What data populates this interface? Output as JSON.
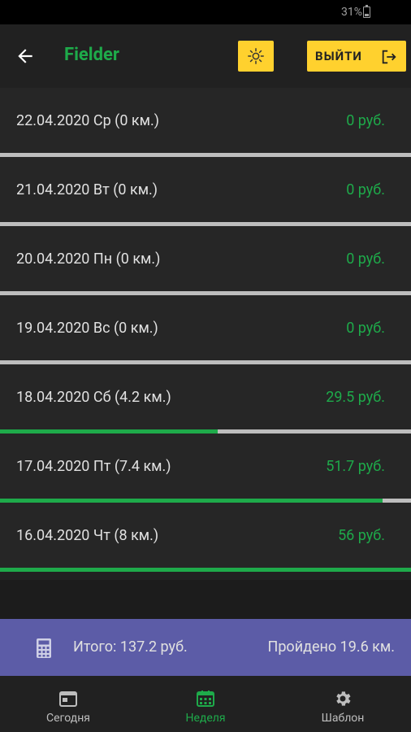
{
  "status_bar": {
    "battery": "31%"
  },
  "app_bar": {
    "title": "Fielder",
    "logout_label": "ВЫЙТИ"
  },
  "days": [
    {
      "label": "22.04.2020 Ср (0 км.)",
      "amount": "0 руб.",
      "progress": 0.0
    },
    {
      "label": "21.04.2020 Вт (0 км.)",
      "amount": "0 руб.",
      "progress": 0.0
    },
    {
      "label": "20.04.2020 Пн (0 км.)",
      "amount": "0 руб.",
      "progress": 0.0
    },
    {
      "label": "19.04.2020 Вс (0 км.)",
      "amount": "0 руб.",
      "progress": 0.0
    },
    {
      "label": "18.04.2020 Сб (4.2 км.)",
      "amount": "29.5 руб.",
      "progress": 0.53
    },
    {
      "label": "17.04.2020 Пт (7.4 км.)",
      "amount": "51.7 руб.",
      "progress": 0.93
    },
    {
      "label": "16.04.2020 Чт (8 км.)",
      "amount": "56 руб.",
      "progress": 1.0
    }
  ],
  "summary": {
    "total": "Итого: 137.2 руб.",
    "distance": "Пройдено 19.6 км."
  },
  "nav": [
    {
      "label": "Сегодня",
      "icon": "calendar-today-icon",
      "active": false
    },
    {
      "label": "Неделя",
      "icon": "calendar-week-icon",
      "active": true
    },
    {
      "label": "Шаблон",
      "icon": "gear-icon",
      "active": false
    }
  ],
  "colors": {
    "accent": "#1eaa4a",
    "button": "#ffd12e",
    "summary_bg": "#5c5ca7",
    "background": "#212121"
  }
}
